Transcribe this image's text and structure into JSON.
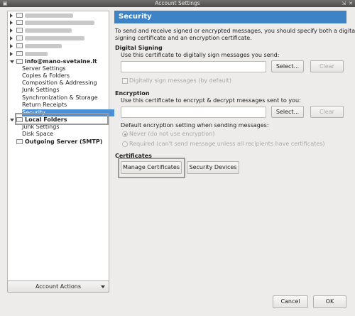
{
  "window": {
    "title": "Account Settings",
    "wm_buttons": [
      "⇲",
      "✕"
    ]
  },
  "tree": {
    "accounts_blurred": [
      {
        "blur_width": 68
      },
      {
        "blur_width": 98
      },
      {
        "blur_width": 66
      },
      {
        "blur_width": 84
      },
      {
        "blur_width": 52
      },
      {
        "blur_width": 32
      }
    ],
    "account": {
      "name": "info@mano-svetaine.lt",
      "items": [
        "Server Settings",
        "Copies & Folders",
        "Composition & Addressing",
        "Junk Settings",
        "Synchronization & Storage",
        "Return Receipts",
        "Security"
      ],
      "selected": "Security"
    },
    "local_folders": {
      "name": "Local Folders",
      "items": [
        "Junk Settings",
        "Disk Space"
      ]
    },
    "outgoing": "Outgoing Server (SMTP)"
  },
  "account_actions": "Account Actions",
  "security": {
    "header": "Security",
    "intro_line1": "To send and receive signed or encrypted messages, you should specify both a digital",
    "intro_line2": "signing certificate and an encryption certificate.",
    "signing": {
      "title": "Digital Signing",
      "prompt": "Use this certificate to digitally sign messages you send:",
      "value": "",
      "select": "Select...",
      "clear": "Clear",
      "checkbox": "Digitally sign messages (by default)"
    },
    "encryption": {
      "title": "Encryption",
      "prompt": "Use this certificate to encrypt & decrypt messages sent to you:",
      "value": "",
      "select": "Select...",
      "clear": "Clear",
      "default_label": "Default encryption setting when sending messages:",
      "never": "Never (do not use encryption)",
      "required": "Required (can't send message unless all recipients have certificates)"
    },
    "certificates": {
      "title": "Certificates",
      "manage": "Manage Certificates",
      "devices": "Security Devices"
    }
  },
  "footer": {
    "cancel": "Cancel",
    "ok": "OK"
  }
}
